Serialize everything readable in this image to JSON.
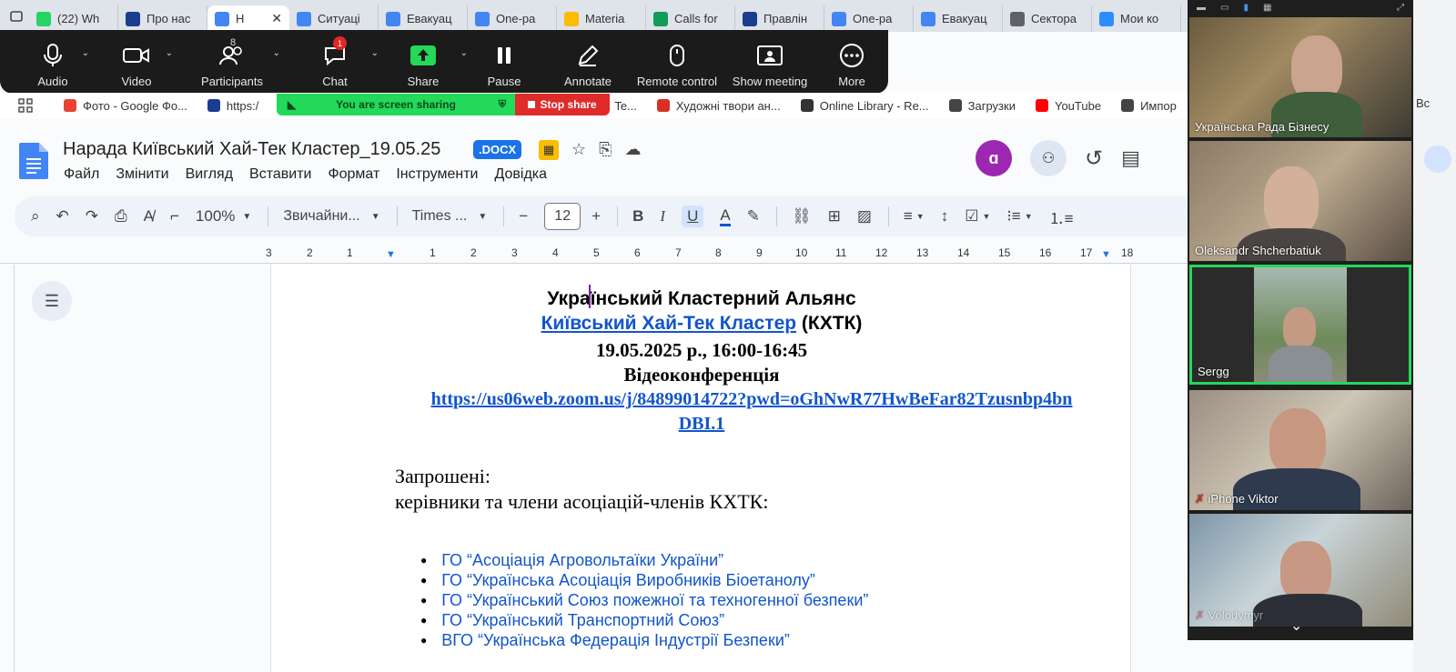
{
  "browser": {
    "tabs": [
      {
        "label": "(22) Wh",
        "icon": "whatsapp-icon",
        "color": "#25d366"
      },
      {
        "label": "Про нас",
        "icon": "site-icon",
        "color": "#1a3d8f"
      },
      {
        "label": "Н",
        "icon": "docs-icon",
        "color": "#4285f4",
        "active": true
      },
      {
        "label": "Ситуаці",
        "icon": "docs-icon",
        "color": "#4285f4"
      },
      {
        "label": "Евакуац",
        "icon": "docs-icon",
        "color": "#4285f4"
      },
      {
        "label": "One-pa",
        "icon": "docs-icon",
        "color": "#4285f4"
      },
      {
        "label": "Materia",
        "icon": "drive-icon",
        "color": "#fbbc04"
      },
      {
        "label": "Calls for",
        "icon": "sheets-icon",
        "color": "#0f9d58"
      },
      {
        "label": "Правлін",
        "icon": "site-icon",
        "color": "#1a3d8f"
      },
      {
        "label": "One-pa",
        "icon": "docs-icon",
        "color": "#4285f4"
      },
      {
        "label": "Евакуац",
        "icon": "docs-icon",
        "color": "#4285f4"
      },
      {
        "label": "Сектора",
        "icon": "globe-icon",
        "color": "#5f6368"
      },
      {
        "label": "Мои ко",
        "icon": "zoom-icon",
        "color": "#2d8cff"
      }
    ],
    "bookmarks": [
      {
        "label": "Фото - Google Фо...",
        "icon": "photos-icon",
        "color": "#ea4335"
      },
      {
        "label": "https:/",
        "icon": "site-icon",
        "color": "#1a3d8f"
      },
      {
        "label": "Te...",
        "icon": "site-icon",
        "color": "#888888"
      },
      {
        "label": "Художні твори ан...",
        "icon": "site-icon",
        "color": "#d93025"
      },
      {
        "label": "Online Library - Re...",
        "icon": "library-icon",
        "color": "#333333"
      },
      {
        "label": "Загрузки",
        "icon": "download-icon",
        "color": "#444444"
      },
      {
        "label": "YouTube",
        "icon": "youtube-icon",
        "color": "#ff0000"
      },
      {
        "label": "Импор",
        "icon": "folder-icon",
        "color": "#444444"
      }
    ],
    "edge_text": "Вс"
  },
  "zoom": {
    "toolbar": [
      {
        "key": "audio",
        "label": "Audio"
      },
      {
        "key": "video",
        "label": "Video"
      },
      {
        "key": "participants",
        "label": "Participants",
        "count": "8"
      },
      {
        "key": "chat",
        "label": "Chat",
        "badge": "1"
      },
      {
        "key": "share",
        "label": "Share"
      },
      {
        "key": "pause",
        "label": "Pause"
      },
      {
        "key": "annotate",
        "label": "Annotate"
      },
      {
        "key": "remote",
        "label": "Remote control"
      },
      {
        "key": "showmeeting",
        "label": "Show meeting"
      },
      {
        "key": "more",
        "label": "More"
      }
    ],
    "sharing_text": "You are screen sharing",
    "stop_share": "Stop share",
    "participants": [
      {
        "name": "Українська Рада Бізнесу"
      },
      {
        "name": "Oleksandr Shcherbatiuk"
      },
      {
        "name": "Sergg",
        "active": true
      },
      {
        "name": "iPhone  Viktor",
        "muted": true
      },
      {
        "name": "Volodymyr",
        "muted": true
      }
    ]
  },
  "docs": {
    "title": "Нарада Київський Хай-Тек Кластер_19.05.25",
    "ext_badge": ".DOCX",
    "menu": [
      "Файл",
      "Змінити",
      "Вигляд",
      "Вставити",
      "Формат",
      "Інструменти",
      "Довідка"
    ],
    "toolbar": {
      "zoom": "100%",
      "style": "Звичайни...",
      "font": "Times ...",
      "font_size": "12"
    },
    "ruler": [
      "3",
      "2",
      "1",
      "1",
      "2",
      "3",
      "4",
      "5",
      "6",
      "7",
      "8",
      "9",
      "10",
      "11",
      "12",
      "13",
      "14",
      "15",
      "16",
      "17",
      "18"
    ],
    "content": {
      "line1": "Український Кластерний Альянс",
      "line2_link": "Київський Хай-Тек Кластер",
      "line2_rest": " (КХТК)",
      "line3": "19.05.2025 р., 16:00-16:45",
      "line4": "Відеоконференція",
      "link_a": "https://us06web.zoom.us/j/84899014722?pwd=oGhNwR77HwBeFar82Tzusnbp4bn",
      "link_b": "DBI.1",
      "invited": "Запрошені:",
      "invited_desc": "керівники та члени асоціацій-членів КХТК:",
      "bullets": [
        "ГО “Асоціація Агровольтаїки України”",
        "ГО “Українська Асоціація Виробників Біоетанолу”",
        "ГО “Український Союз пожежної та техногенної безпеки”",
        "ГО “Український Транспортний Союз”",
        "ВГО “Українська Федерація Індустрії Безпеки”"
      ]
    }
  }
}
